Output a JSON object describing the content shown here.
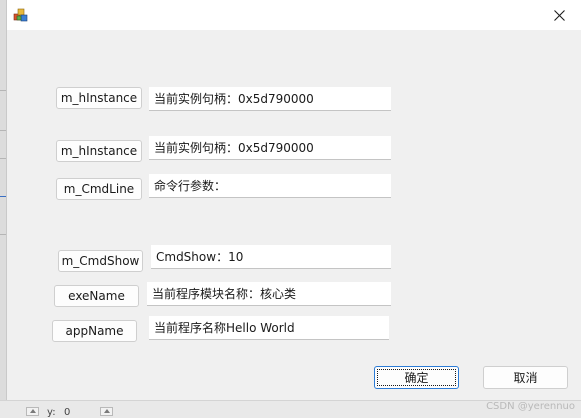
{
  "background": {
    "bottom_bar": {
      "label_left": "y:",
      "label_value": "0"
    },
    "watermark": "CSDN @yerennuo"
  },
  "dialog": {
    "title": "",
    "close_glyph": "✕",
    "rows": [
      {
        "button_label": "m_hInstance",
        "field_value": "当前实例句柄：0x5d790000"
      },
      {
        "button_label": "m_hInstance",
        "field_value": "当前实例句柄：0x5d790000"
      },
      {
        "button_label": "m_CmdLine",
        "field_value": "命令行参数："
      },
      {
        "button_label": "m_CmdShow",
        "field_value": "CmdShow：10"
      },
      {
        "button_label": "exeName",
        "field_value": "当前程序模块名称：核心类"
      },
      {
        "button_label": "appName",
        "field_value": "当前程序名称Hello World"
      }
    ],
    "ok_label": "确定",
    "cancel_label": "取消"
  },
  "icons": {
    "app": "mfc-app-icon",
    "close": "close-icon"
  },
  "colors": {
    "dialog_bg": "#f0f0f0",
    "titlebar_bg": "#ffffff",
    "default_button_border": "#2b7bd6"
  }
}
